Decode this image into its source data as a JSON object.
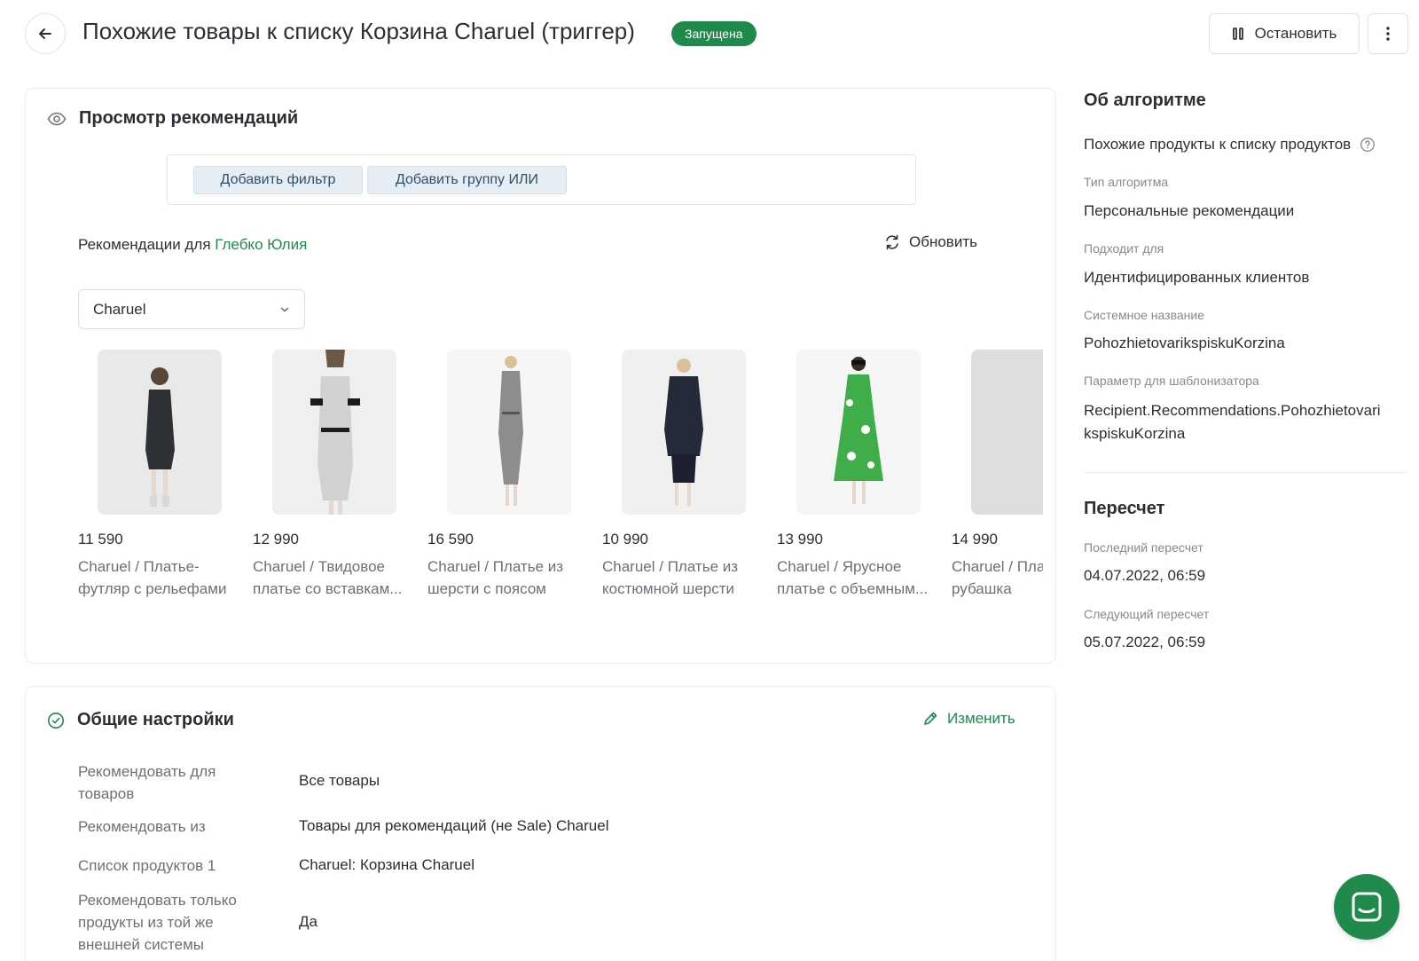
{
  "header": {
    "title": "Похожие товары к списку Корзина Charuel (триггер)",
    "status": "Запущена",
    "stop_label": "Остановить"
  },
  "preview": {
    "title": "Просмотр рекомендаций",
    "add_filter": "Добавить фильтр",
    "add_or_group": "Добавить группу ИЛИ",
    "rec_for_label": "Рекомендации для",
    "rec_for_user": "Глебко Юлия",
    "refresh": "Обновить",
    "brand_select": "Charuel",
    "products": [
      {
        "price": "11 590",
        "name1": "Charuel / Платье-",
        "name2": "футляр с рельефами",
        "color": "#2e3236"
      },
      {
        "price": "12 990",
        "name1": "Charuel / Твидовое",
        "name2": "платье со вставкам...",
        "color": "#c9ccca"
      },
      {
        "price": "16 590",
        "name1": "Charuel / Платье из",
        "name2": "шерсти с поясом",
        "color": "#8b8d8f"
      },
      {
        "price": "10 990",
        "name1": "Charuel / Платье из",
        "name2": "костюмной шерсти",
        "color": "#252a38"
      },
      {
        "price": "13 990",
        "name1": "Charuel / Ярусное",
        "name2": "платье с объемным...",
        "color": "#3fae4a"
      },
      {
        "price": "14 990",
        "name1": "Charuel / Платье-",
        "name2": "рубашка",
        "color": "#dcdede"
      }
    ]
  },
  "settings": {
    "title": "Общие настройки",
    "edit": "Изменить",
    "rows": [
      {
        "label": "Рекомендовать для товаров",
        "value": "Все товары"
      },
      {
        "label": "Рекомендовать из",
        "value": "Товары для рекомендаций (не Sale) Charuel"
      },
      {
        "label": "Список продуктов 1",
        "value": "Charuel: Корзина Charuel"
      },
      {
        "label": "Рекомендовать только продукты из той же внешней системы",
        "value": "Да"
      }
    ]
  },
  "algorithm": {
    "title": "Об алгоритме",
    "name": "Похожие продукты к списку продуктов",
    "type_label": "Тип алгоритма",
    "type_value": "Персональные рекомендации",
    "fits_label": "Подходит для",
    "fits_value": "Идентифицированных клиентов",
    "system_name_label": "Системное название",
    "system_name_value": "PohozhietovarikspiskuKorzina",
    "template_param_label": "Параметр для шаблонизатора",
    "template_param_value_1": "Recipient.Recommendations.Pohozhietovari",
    "template_param_value_2": "kspiskuKorzina"
  },
  "recalc": {
    "title": "Пересчет",
    "last_label": "Последний пересчет",
    "last_value": "04.07.2022, 06:59",
    "next_label": "Следующий пересчет",
    "next_value": "05.07.2022, 06:59"
  },
  "icons": {
    "back": "arrow-left-icon",
    "stop": "pause-icon",
    "more": "kebab-menu-icon",
    "preview": "eye-icon",
    "refresh": "refresh-icon",
    "select": "chevron-down-icon",
    "settings": "check-circle-icon",
    "edit": "pencil-icon",
    "help": "question-circle-icon",
    "chat": "chat-icon"
  },
  "colors": {
    "accent": "#1f8a4c",
    "text": "#2b2f33",
    "muted": "#6b7177"
  }
}
